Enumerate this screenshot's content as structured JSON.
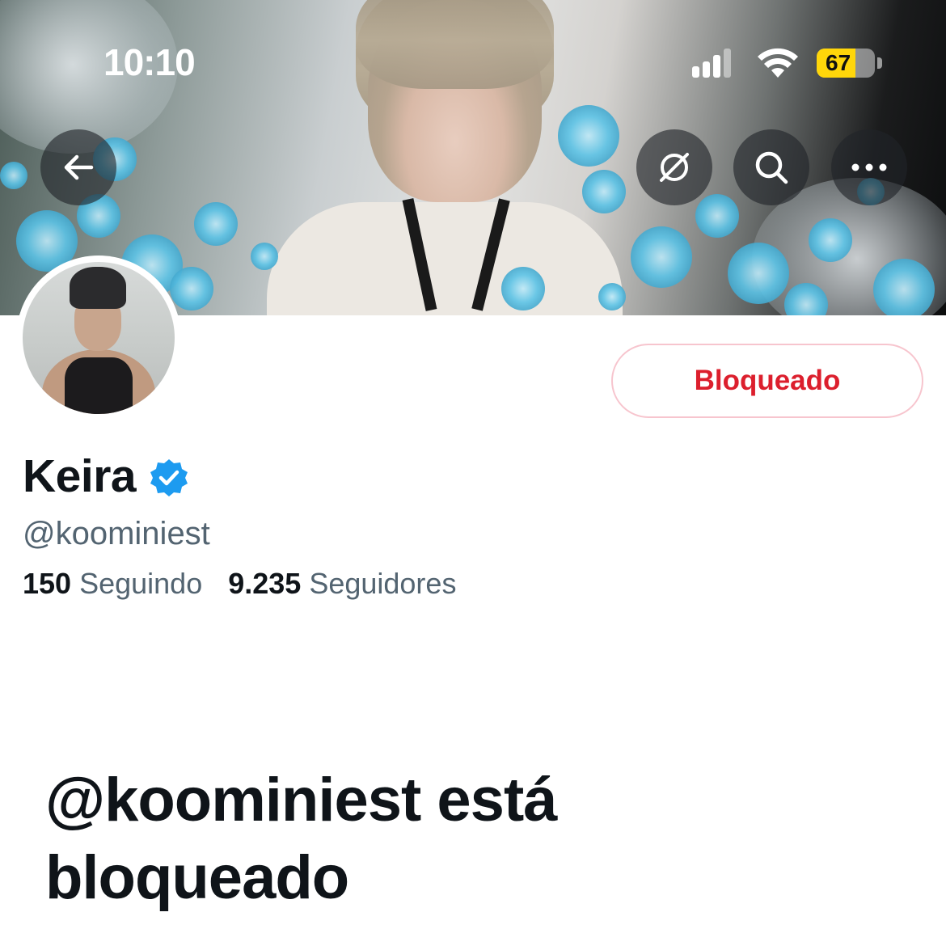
{
  "status_bar": {
    "time": "10:10",
    "battery_percent": "67",
    "battery_level": 0.67,
    "signal_icon": "cellular-signal-icon",
    "wifi_icon": "wifi-icon"
  },
  "header": {
    "back_icon": "arrow-left-icon",
    "mute_icon": "slashed-circle-icon",
    "search_icon": "search-icon",
    "more_icon": "more-horizontal-icon"
  },
  "profile": {
    "display_name": "Keira",
    "verified_icon": "verified-badge-icon",
    "handle": "@koominiest",
    "following_count": "150",
    "following_label": "Seguindo",
    "followers_count": "9.235",
    "followers_label": "Seguidores",
    "blocked_button_label": "Bloqueado"
  },
  "blocked_notice": {
    "title": "@koominiest está bloqueado"
  },
  "colors": {
    "accent_blue": "#1d9bf0",
    "blocked_red": "#dc1f2d",
    "blocked_border": "#f7c5ce",
    "secondary_text": "#536471",
    "battery_yellow": "#ffd60a"
  }
}
